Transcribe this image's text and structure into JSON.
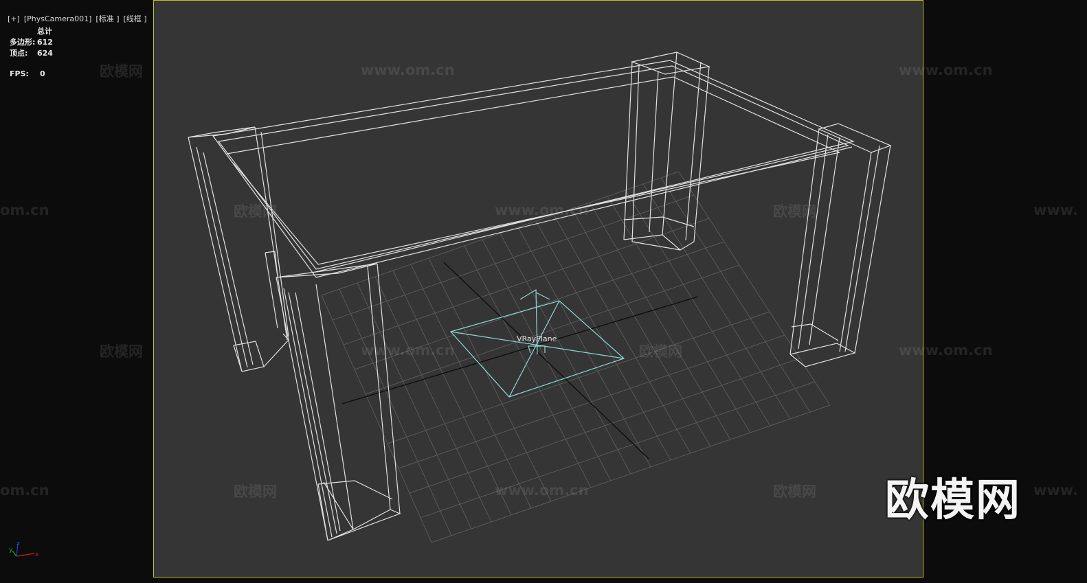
{
  "viewport": {
    "labels": [
      "[+]",
      "[PhysCamera001]",
      "[标准 ]",
      "[线框 ]"
    ]
  },
  "stats": {
    "header": "总计",
    "polygons_label": "多边形:",
    "polygons_value": "612",
    "vertices_label": "顶点:",
    "vertices_value": "624",
    "fps_label": "FPS:",
    "fps_value": "0"
  },
  "object_label": "VRayPlane",
  "watermarks": {
    "text_cn": "欧模网",
    "text_url": "www.om.cn",
    "text_url_partial": "www.",
    "text_cn_partial": "om.cn"
  },
  "logo": "欧模网",
  "axis_gizmo": {
    "x": "x",
    "y": "y",
    "z": "z"
  },
  "colors": {
    "viewport_bg": "#353535",
    "border_active": "#c8c020",
    "wireframe": "#e0e0e0",
    "grid": "#5a5a5a",
    "light_helper": "#8fd8d8"
  }
}
